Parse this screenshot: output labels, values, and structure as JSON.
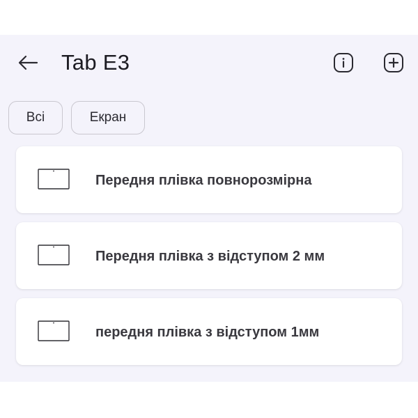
{
  "appbar": {
    "title": "Tab E3",
    "back_icon": "arrow-left-icon",
    "info_icon": "info-icon",
    "add_icon": "add-icon"
  },
  "filters": [
    {
      "label": "Всі"
    },
    {
      "label": "Екран"
    }
  ],
  "items": [
    {
      "label": "Передня плівка повнорозмірна",
      "icon": "screen-film-icon"
    },
    {
      "label": "Передня плівка з відступом 2 мм",
      "icon": "screen-film-icon"
    },
    {
      "label": "передня плівка з відступом 1мм",
      "icon": "screen-film-icon"
    }
  ],
  "colors": {
    "background": "#f4f3fb",
    "card": "#ffffff",
    "text": "#1c1b22",
    "chip_border": "#c9c7cf"
  }
}
